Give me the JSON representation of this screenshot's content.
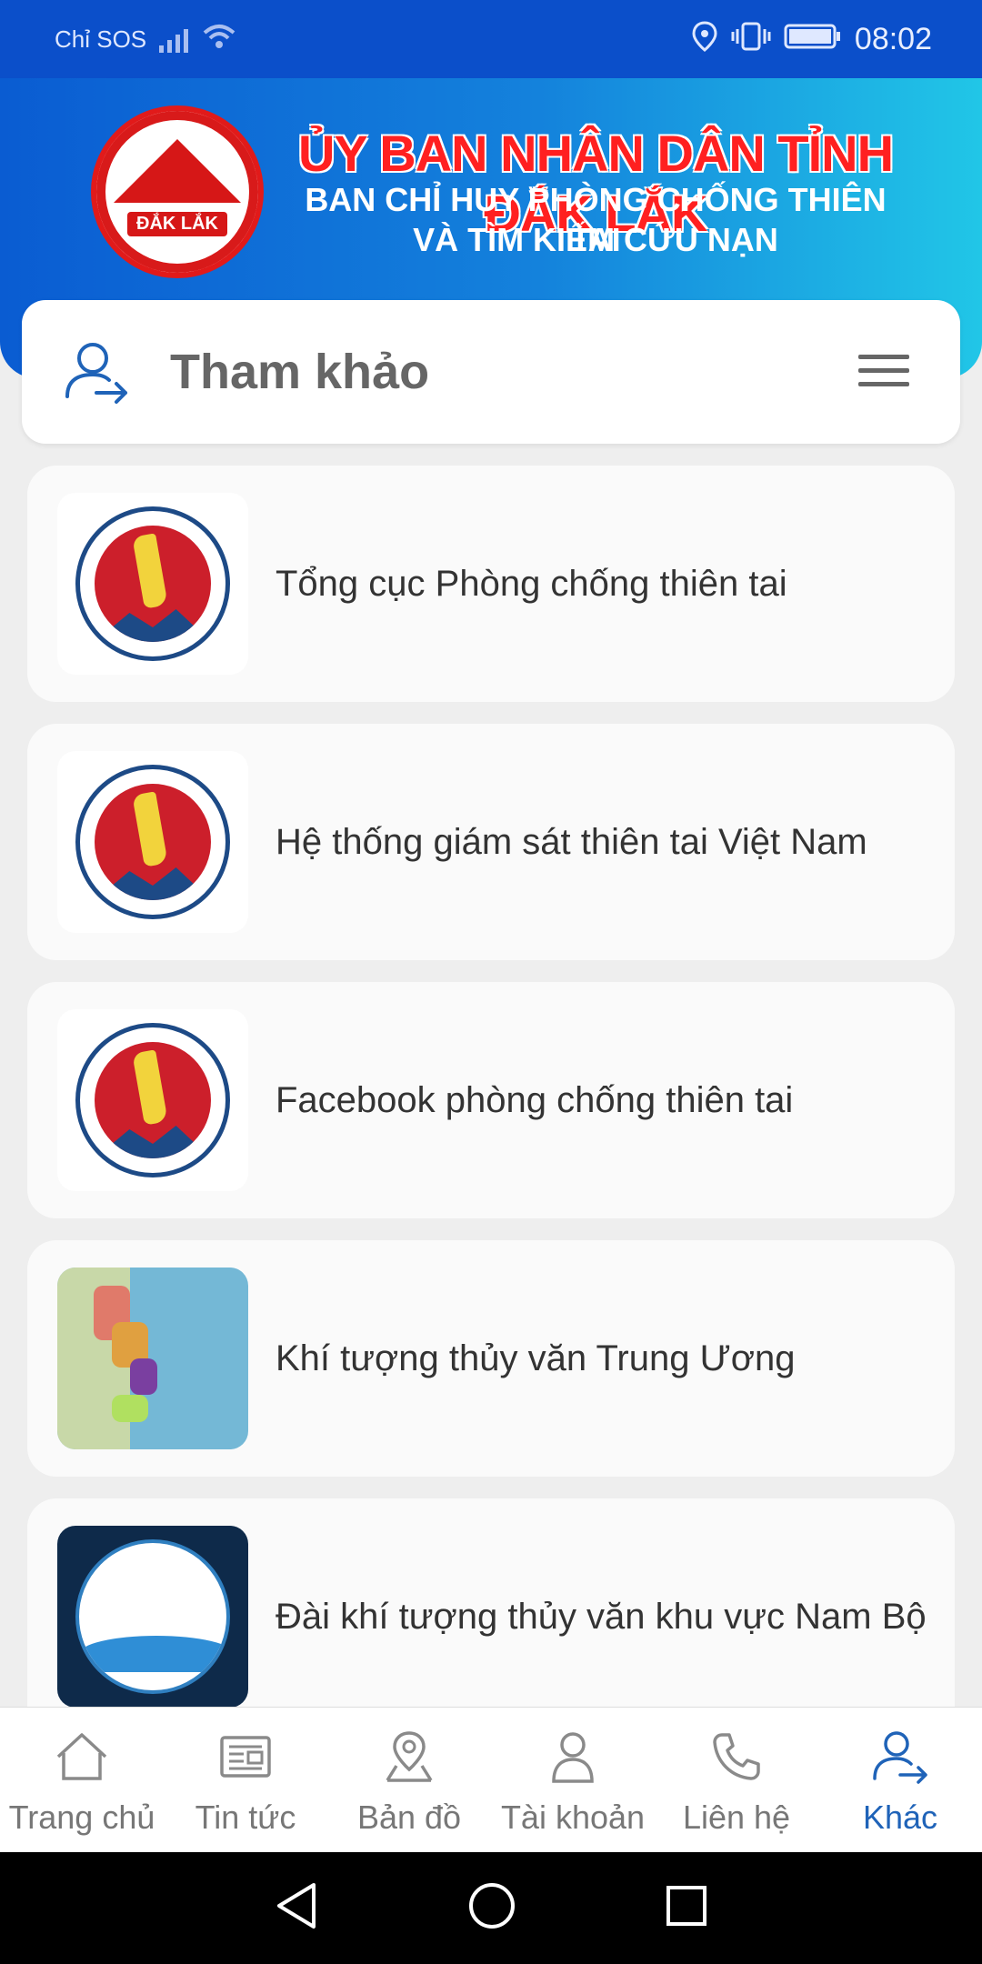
{
  "status_bar": {
    "carrier": "Chỉ SOS",
    "time": "08:02"
  },
  "banner": {
    "logo_text": "ĐẮK LẮK",
    "title": "ỦY BAN NHÂN DÂN TỈNH ĐẮK LẮK",
    "subtitle_line1": "BAN CHỈ HUY PHÒNG CHỐNG THIÊN TAI",
    "subtitle_line2": "VÀ TÌM KIẾM CỨU NẠN"
  },
  "page_header": {
    "title": "Tham khảo"
  },
  "list": {
    "items": [
      {
        "label": "Tổng cục Phòng chống thiên tai",
        "icon": "seal-logo"
      },
      {
        "label": "Hệ thống giám sát thiên tai Việt Nam",
        "icon": "seal-logo"
      },
      {
        "label": "Facebook phòng chống thiên tai",
        "icon": "seal-logo"
      },
      {
        "label": "Khí tượng thủy văn Trung Ương",
        "icon": "map-thumbnail"
      },
      {
        "label": "Đài khí tượng thủy văn khu vực Nam Bộ",
        "icon": "weather-station-logo"
      }
    ]
  },
  "bottom_nav": {
    "items": [
      {
        "label": "Trang chủ",
        "icon": "home-icon"
      },
      {
        "label": "Tin tức",
        "icon": "news-icon"
      },
      {
        "label": "Bản đồ",
        "icon": "map-pin-icon"
      },
      {
        "label": "Tài khoản",
        "icon": "person-icon"
      },
      {
        "label": "Liên hệ",
        "icon": "phone-icon"
      },
      {
        "label": "Khác",
        "icon": "user-share-icon"
      }
    ],
    "active_index": 5
  },
  "colors": {
    "status_bar": "#0b4fca",
    "accent": "#1f63b8",
    "banner_red": "#ff2020"
  }
}
